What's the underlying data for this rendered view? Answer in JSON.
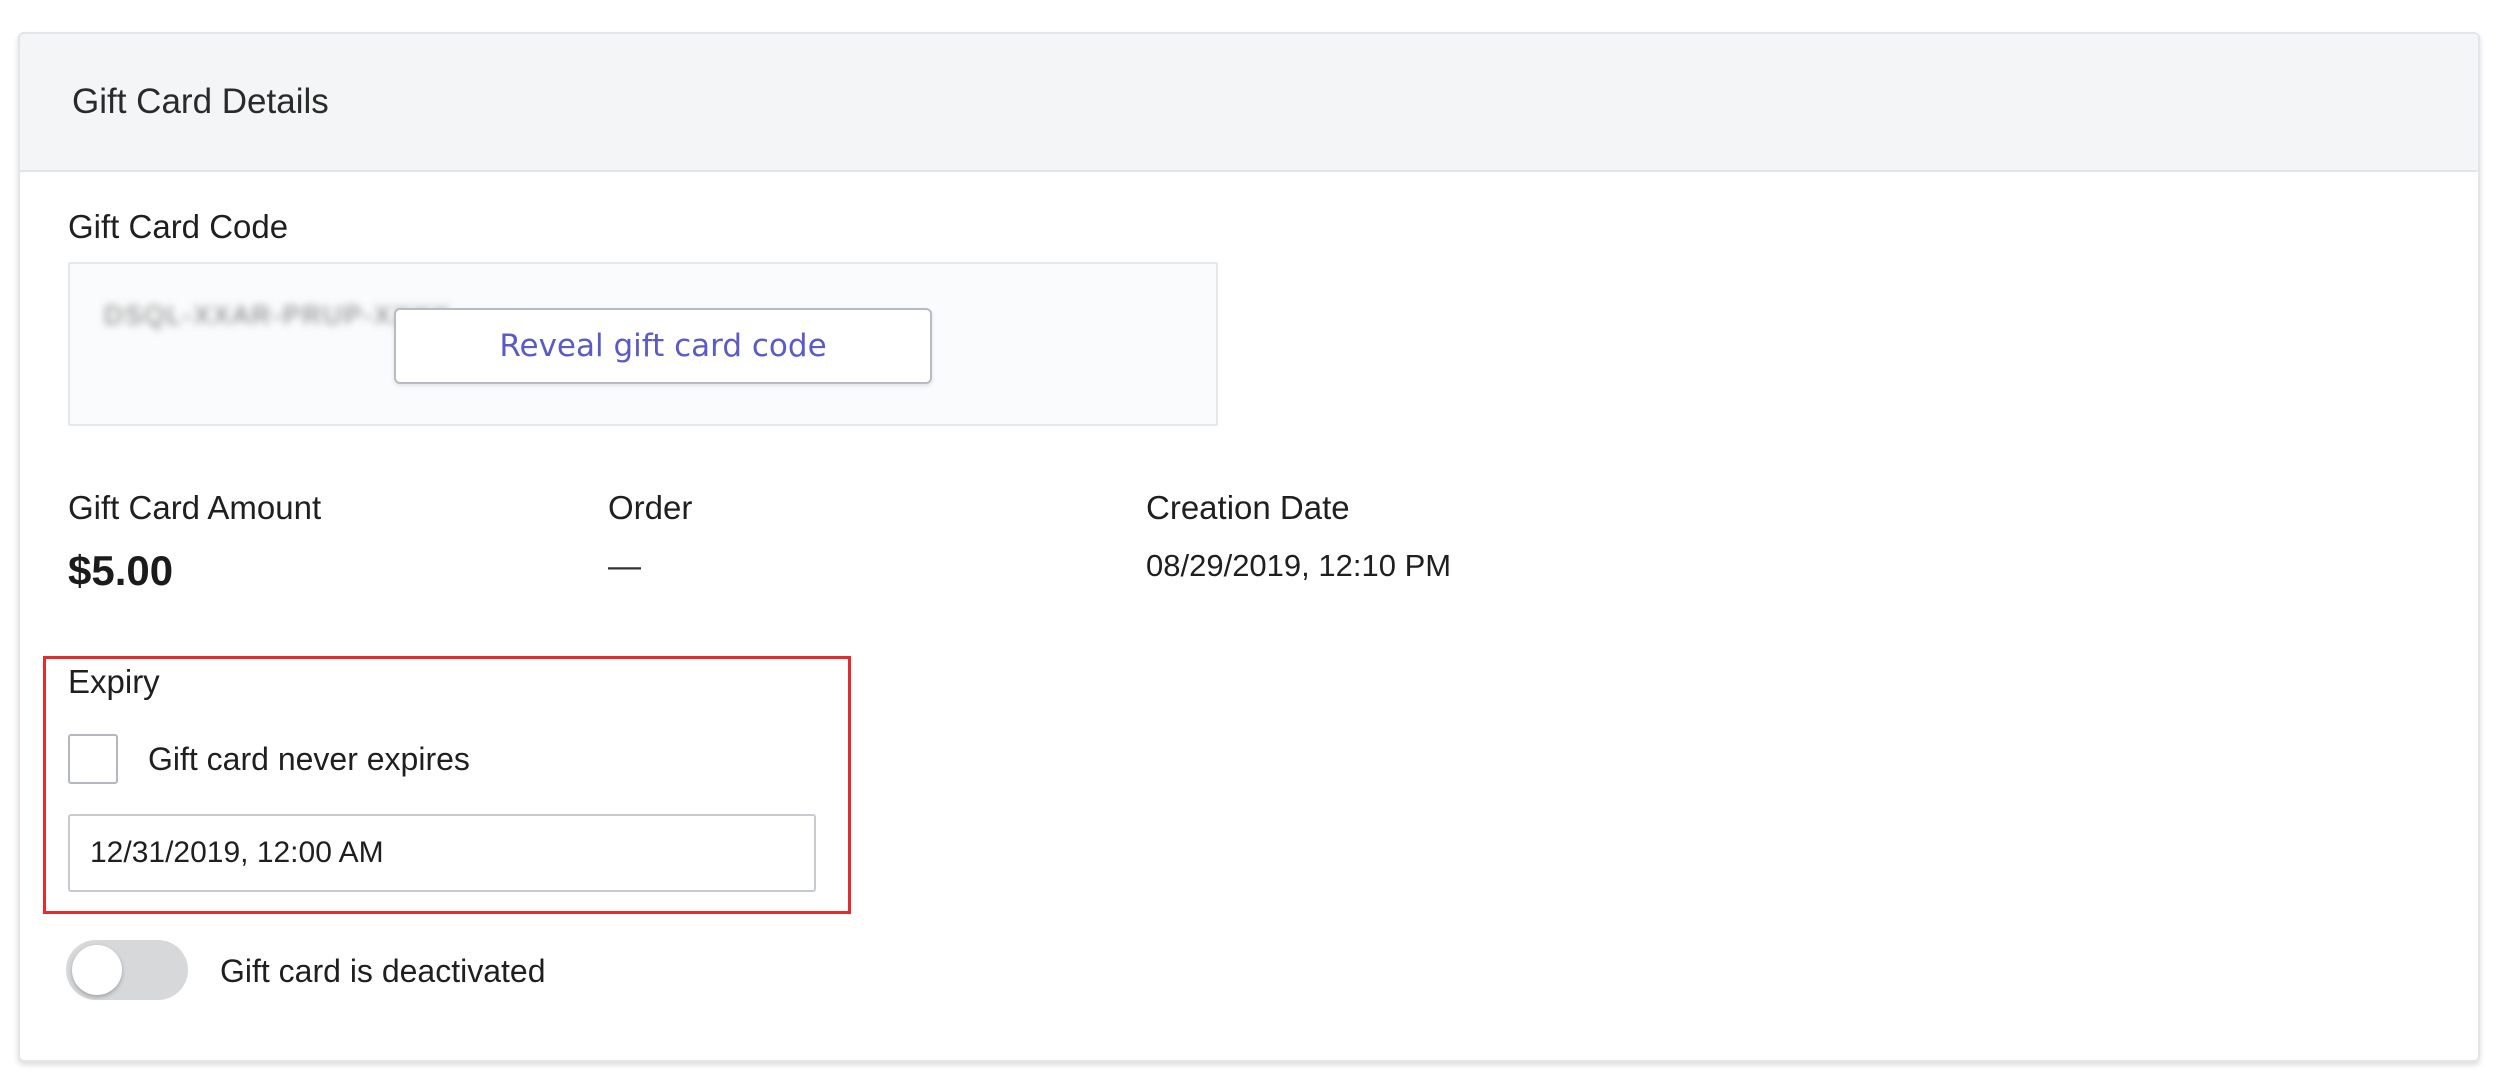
{
  "card": {
    "title": "Gift Card Details"
  },
  "gift_card_code": {
    "label": "Gift Card Code",
    "masked_code": "DSQL-XXAR-PRUP-XXXX",
    "reveal_button_label": "Reveal gift card code"
  },
  "details": {
    "amount_label": "Gift Card Amount",
    "amount_value": "$5.00",
    "order_label": "Order",
    "order_value": "—",
    "creation_date_label": "Creation Date",
    "creation_date_value": "08/29/2019, 12:10 PM"
  },
  "expiry": {
    "label": "Expiry",
    "never_expires_label": "Gift card never expires",
    "never_expires_checked": false,
    "expiry_date_value": "12/31/2019, 12:00 AM"
  },
  "deactivation": {
    "toggle_label": "Gift card is deactivated",
    "toggle_on": false
  },
  "colors": {
    "accent_link": "#5b5bc6",
    "highlight_border": "#e52b2b",
    "header_bg": "#f4f5f6"
  }
}
